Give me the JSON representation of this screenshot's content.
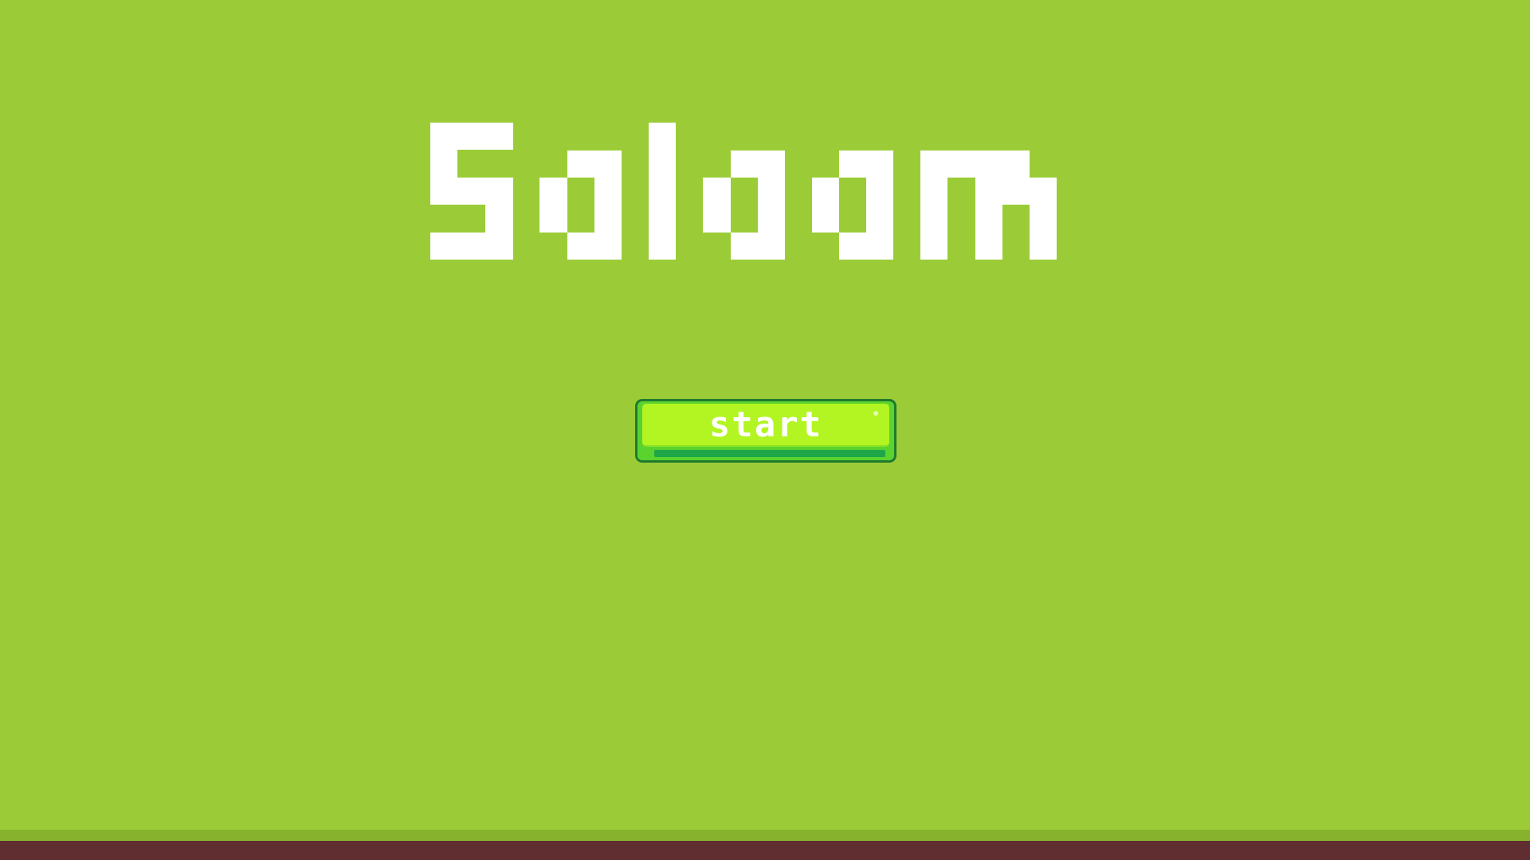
{
  "game": {
    "title": "Salaam",
    "start_label": "start"
  },
  "colors": {
    "sky": "#9bcc37",
    "title": "#ffffff",
    "button_face": "#b2f522",
    "button_outline": "#1f7a2f",
    "button_rim": "#5bd32e",
    "grass": "#86b22d",
    "dirt": "#602d31"
  }
}
